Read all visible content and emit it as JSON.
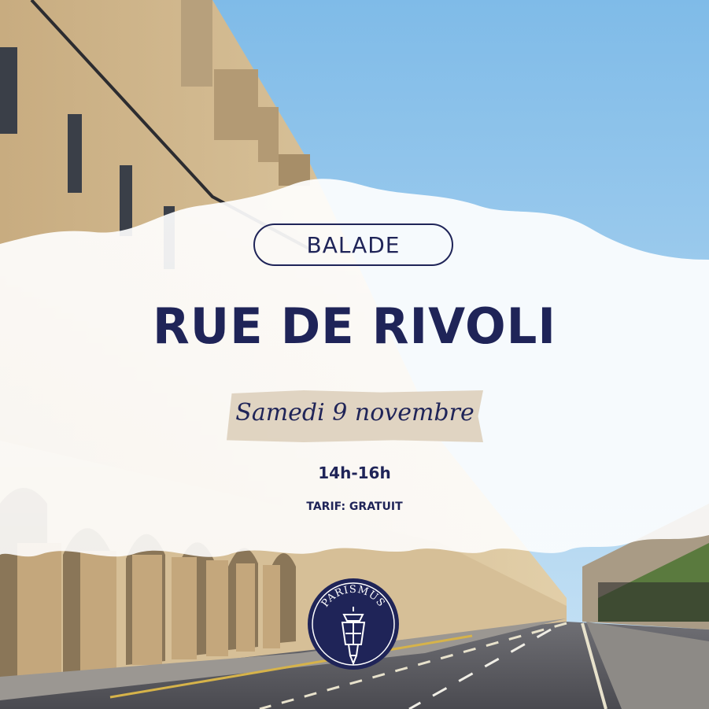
{
  "badge": {
    "label": "BALADE"
  },
  "title": "RUE DE RIVOLI",
  "date": "Samedi 9 novembre",
  "hours": "14h-16h",
  "price": "TARIF: GRATUIT",
  "logo": {
    "text": "PARISMUS",
    "icon": "street-lamp-icon"
  },
  "colors": {
    "navy": "#1f2458",
    "sky": "#8fc3ea",
    "stone": "#cdb48c",
    "tape": "#ddd0bd"
  }
}
